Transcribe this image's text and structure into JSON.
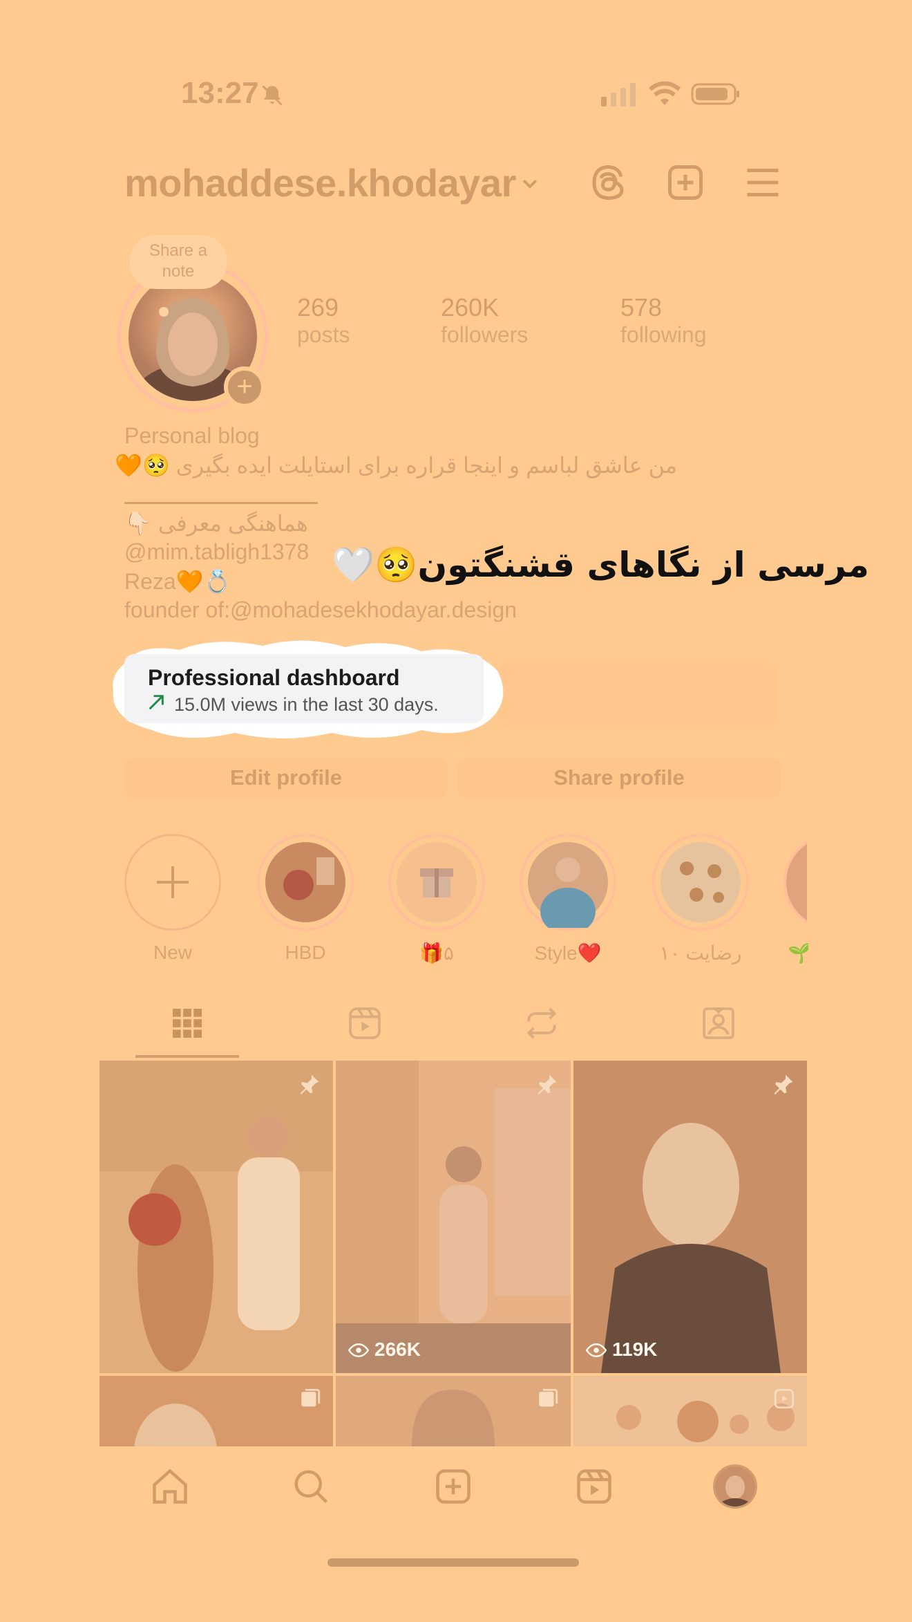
{
  "status_bar": {
    "time": "13:27"
  },
  "header": {
    "username": "mohaddese.khodayar"
  },
  "profile": {
    "note_label": "Share a\nnote",
    "stats": [
      {
        "value": "269",
        "label": "posts"
      },
      {
        "value": "260K",
        "label": "followers"
      },
      {
        "value": "578",
        "label": "following"
      }
    ],
    "category": "Personal blog",
    "bio_line1": "من عاشق لباسم و اینجا قراره برای استایلت ایده بگیری 🥺🧡",
    "bio_line2": "هماهنگی معرفی 👇🏻",
    "bio_mention": "@mim.tabligh1378",
    "bio_line4": "Reza🧡💍",
    "bio_founder_prefix": "founder of:",
    "bio_founder_link": "@mohadesekhodayar.design"
  },
  "overlay_caption": "مرسی از نگاهای قشنگتون🥺🤍",
  "dashboard": {
    "title": "Professional dashboard",
    "subtitle": "15.0M views in the last 30 days."
  },
  "buttons": {
    "edit": "Edit profile",
    "share": "Share profile"
  },
  "highlights": [
    {
      "label": "New"
    },
    {
      "label": "HBD"
    },
    {
      "label": "🎁۵"
    },
    {
      "label": "Style❤️"
    },
    {
      "label": "رضایت ۱۰"
    },
    {
      "label": "🌱"
    }
  ],
  "grid": [
    {
      "views": ""
    },
    {
      "views": "266K"
    },
    {
      "views": "119K"
    }
  ],
  "colors": {
    "overlay_bg": "#ffca8f",
    "accent": "#d09c68",
    "trend_green": "#1d8b45"
  }
}
